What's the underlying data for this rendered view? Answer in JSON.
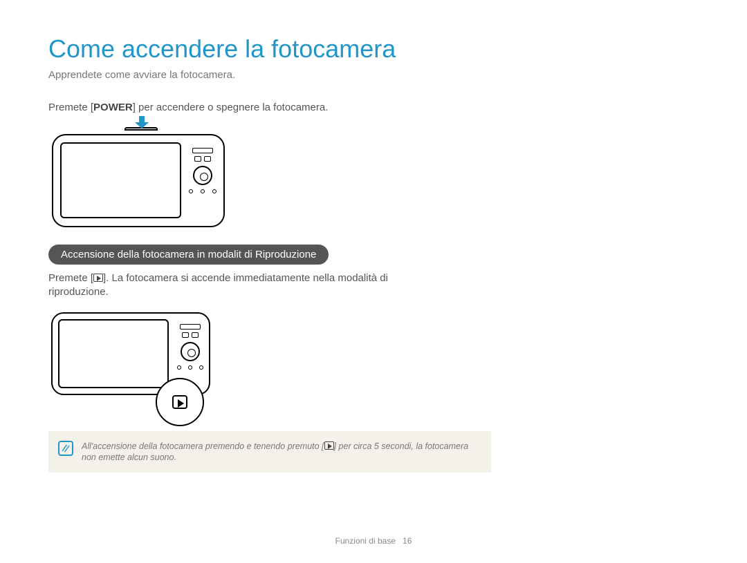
{
  "title": "Come accendere la fotocamera",
  "subtitle": "Apprendete come avviare la fotocamera.",
  "instruction": {
    "pre": "Premete [",
    "bold": "POWER",
    "post": "] per accendere o spegnere la fotocamera."
  },
  "section_header": "Accensione della fotocamera in modalit  di Riproduzione",
  "paragraph_2": {
    "pre": "Premete [",
    "post": "]. La fotocamera si accende immediatamente nella modalità di riproduzione."
  },
  "note": {
    "pre": "All'accensione della fotocamera premendo e tenendo premuto [",
    "post": "] per circa 5 secondi, la fotocamera non emette alcun suono."
  },
  "footer": {
    "label": "Funzioni di base",
    "page": "16"
  }
}
